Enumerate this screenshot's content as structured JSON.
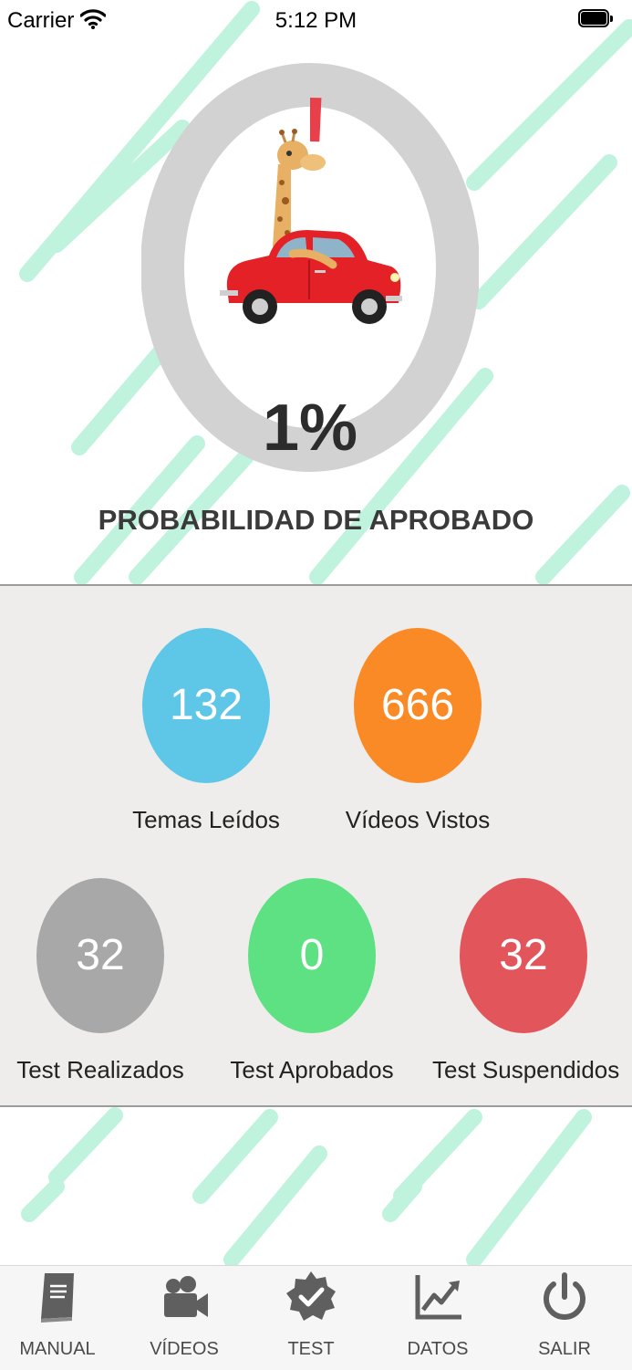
{
  "status_bar": {
    "carrier": "Carrier",
    "time": "5:12 PM"
  },
  "progress": {
    "value_label": "1%",
    "fraction": 0.01,
    "track_color": "#d2d2d2",
    "fill_color": "#e8404a"
  },
  "probability_title": "PROBABILIDAD DE APROBADO",
  "stats": [
    {
      "value": "132",
      "label": "Temas Leídos",
      "color": "#5ec6e6"
    },
    {
      "value": "666",
      "label": "Vídeos Vistos",
      "color": "#f98a25"
    },
    {
      "value": "32",
      "label": "Test Realizados",
      "color": "#a8a8a8"
    },
    {
      "value": "0",
      "label": "Test Aprobados",
      "color": "#5de182"
    },
    {
      "value": "32",
      "label": "Test Suspendidos",
      "color": "#e2555a"
    }
  ],
  "tabs": [
    {
      "label": "MANUAL",
      "icon": "book-icon"
    },
    {
      "label": "VÍDEOS",
      "icon": "video-camera-icon"
    },
    {
      "label": "TEST",
      "icon": "badge-check-icon"
    },
    {
      "label": "DATOS",
      "icon": "chart-trend-icon"
    },
    {
      "label": "SALIR",
      "icon": "power-icon"
    }
  ],
  "colors": {
    "stripe": "#bff3de",
    "panel_background": "#efedec",
    "tab_icon": "#5f5f5f"
  }
}
